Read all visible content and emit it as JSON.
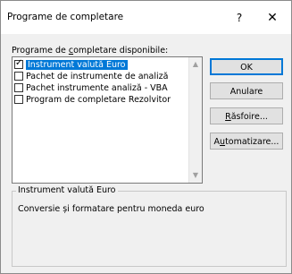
{
  "window": {
    "title": "Programe de completare",
    "help_label": "?",
    "close_label": "✕"
  },
  "list": {
    "label_pre": "Programe de ",
    "label_accel": "c",
    "label_post": "ompletare disponibile:",
    "items": [
      {
        "label": "Instrument valută Euro",
        "checked": true,
        "selected": true
      },
      {
        "label": "Pachet de instrumente de analiză",
        "checked": false,
        "selected": false
      },
      {
        "label": "Pachet instrumente analiză - VBA",
        "checked": false,
        "selected": false
      },
      {
        "label": "Program de completare Rezolvitor",
        "checked": false,
        "selected": false
      }
    ]
  },
  "buttons": {
    "ok": "OK",
    "cancel": "Anulare",
    "browse_accel": "R",
    "browse_rest": "ăsfoire...",
    "automation_pre": "A",
    "automation_accel": "u",
    "automation_post": "tomatizare..."
  },
  "details": {
    "title": "Instrument valută Euro",
    "description": "Conversie și formatare pentru moneda euro"
  }
}
